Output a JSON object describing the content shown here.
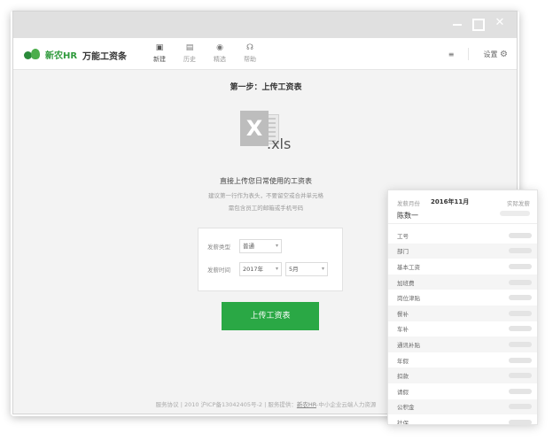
{
  "window": {
    "controls": {
      "minimize": "",
      "maximize": "",
      "close": "✕"
    }
  },
  "toolbar": {
    "logo_text": "新农HR",
    "app_name": "万能工资条",
    "nav": [
      {
        "label": "新建",
        "icon": "new-icon",
        "glyph": "▣"
      },
      {
        "label": "历史",
        "icon": "history-icon",
        "glyph": "▤"
      },
      {
        "label": "精选",
        "icon": "featured-icon",
        "glyph": "◉"
      },
      {
        "label": "帮助",
        "icon": "help-icon",
        "glyph": "☊"
      }
    ],
    "right_link": "≡",
    "settings_label": "设置",
    "settings_icon": "⚙"
  },
  "main": {
    "step_title": "第一步：上传工资表",
    "file_icon_letter": "X",
    "file_ext": ".xls",
    "desc_main": "直接上传您日常使用的工资表",
    "desc_hint1": "建议第一行作为表头，不要留空或合并单元格",
    "desc_hint2": "需包含员工的邮箱或手机号码",
    "form": {
      "type_label": "发薪类型",
      "type_value": "普通",
      "time_label": "发薪时间",
      "year_value": "2017年",
      "month_value": "5月",
      "dropdown_glyph": "▾"
    },
    "upload_button": "上传工资表"
  },
  "footer": {
    "text_left": "服务协议 | 2010 沪ICP备13042405号-2 | 服务提供：",
    "link": "新农HR",
    "text_right": "-中小企业云端人力资源"
  },
  "card": {
    "period_label": "发薪月份",
    "period": "2016年11月",
    "right_label": "实际发薪",
    "employee_name": "陈数一",
    "fields": [
      "工号",
      "部门",
      "基本工资",
      "加班费",
      "岗位津贴",
      "餐补",
      "车补",
      "通讯补贴",
      "年假",
      "扣款",
      "请假",
      "公积金",
      "社保"
    ]
  }
}
